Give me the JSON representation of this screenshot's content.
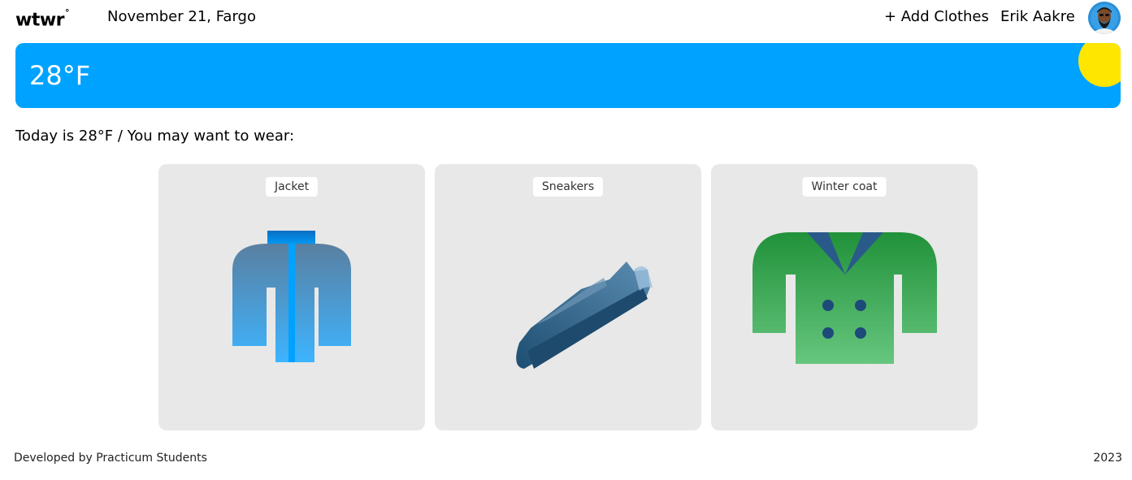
{
  "header": {
    "logo": "wtwr",
    "logo_mark": "°",
    "date_location": "November 21, Fargo",
    "add_clothes_label": "+ Add Clothes",
    "username": "Erik Aakre"
  },
  "weather": {
    "temperature": "28°F",
    "condition_icon": "sun-icon",
    "card_color": "#00a2ff",
    "sun_color": "#ffe600"
  },
  "main": {
    "recommendation": "Today is 28°F / You may want to wear:",
    "items": [
      {
        "label": "Jacket",
        "icon": "jacket-icon"
      },
      {
        "label": "Sneakers",
        "icon": "sneaker-icon"
      },
      {
        "label": "Winter coat",
        "icon": "winter-coat-icon"
      }
    ]
  },
  "footer": {
    "credit": "Developed by Practicum Students",
    "year": "2023"
  }
}
